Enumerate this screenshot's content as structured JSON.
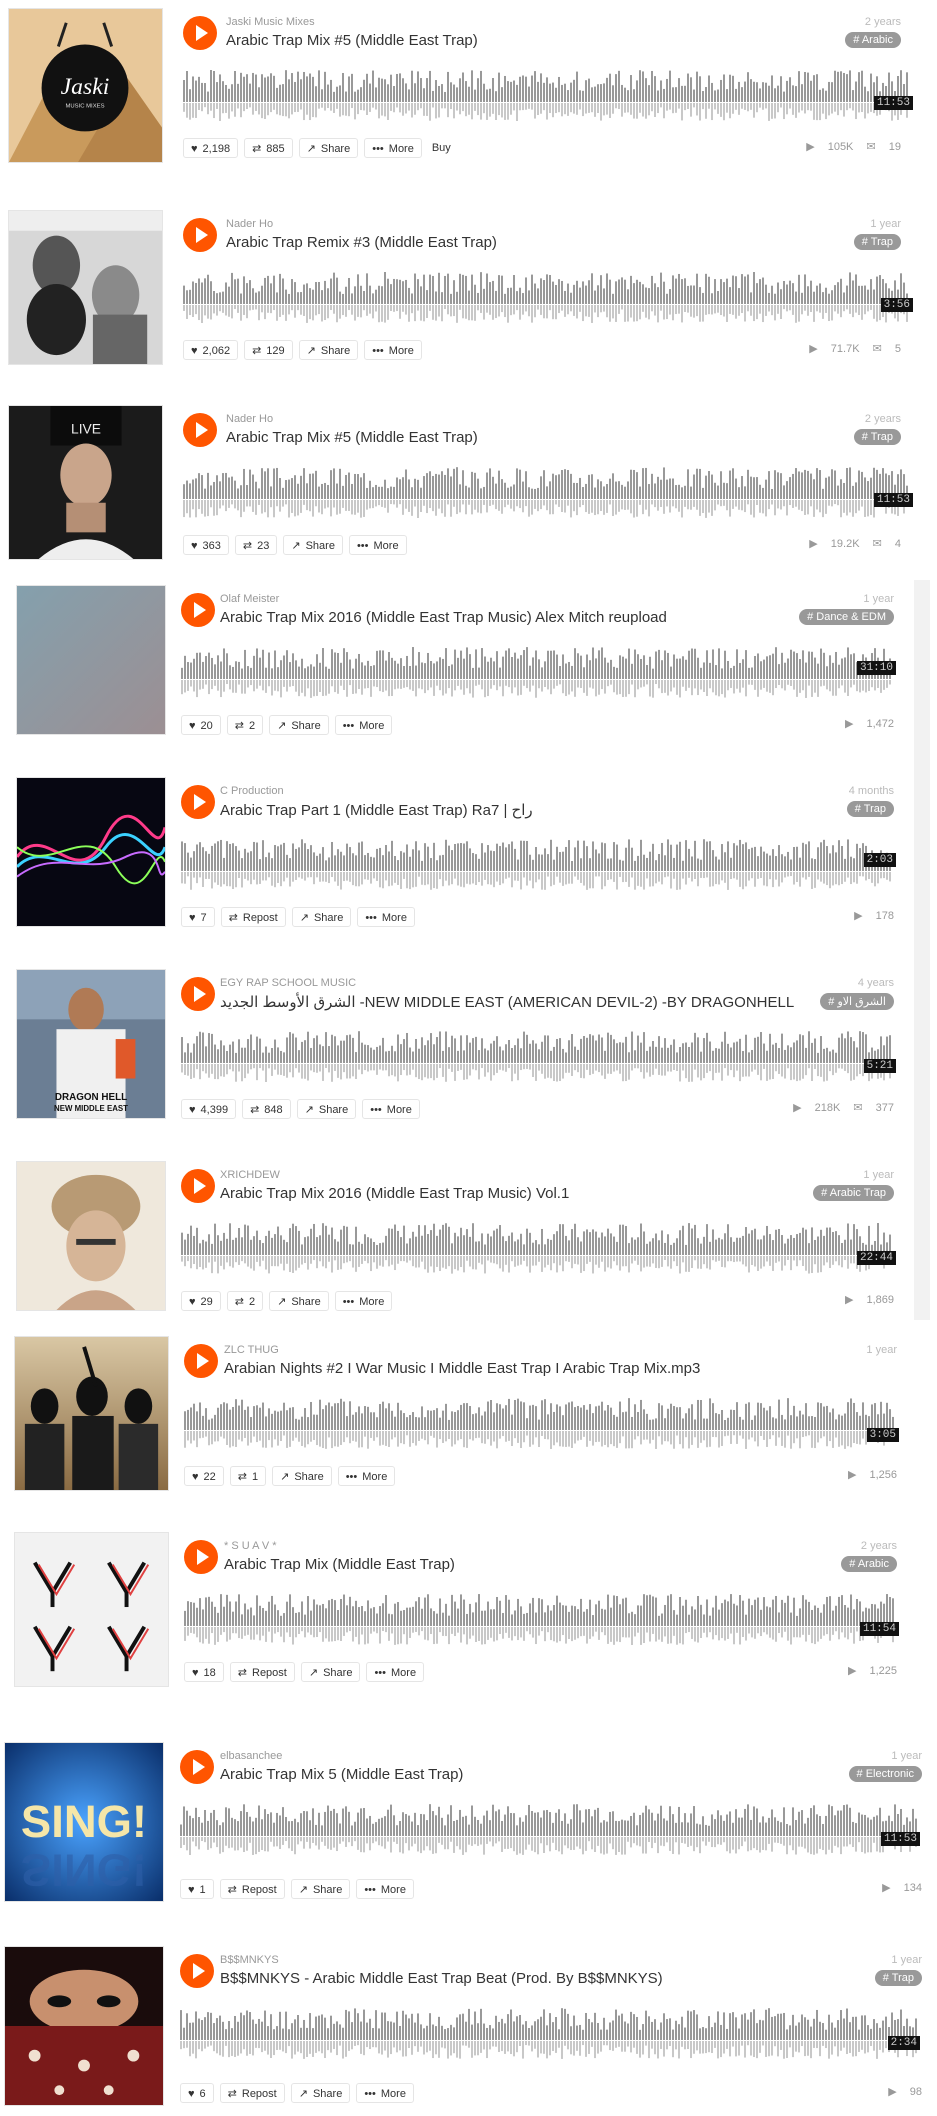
{
  "colors": {
    "accent": "#ff5500",
    "wave": "#999999",
    "tag_bg": "#999999"
  },
  "icons": {
    "play": "play-icon",
    "like": "heart-icon",
    "repost": "repost-icon",
    "share": "share-icon",
    "more": "more-icon",
    "plays": "play-count-icon",
    "comments": "comment-icon"
  },
  "tracks": [
    {
      "user": "Jaski Music Mixes",
      "title": "Arabic Trap Mix #5 (Middle East Trap)",
      "age": "2 years",
      "tag": "Arabic",
      "duration": "11:53",
      "likes": "2,198",
      "reposts": "885",
      "share": "Share",
      "more": "More",
      "buy": "Buy",
      "plays": "105K",
      "comments": "19",
      "art_text": "Jaski",
      "art_sub": "MUSIC MIXES"
    },
    {
      "user": "Nader Ho",
      "title": "Arabic Trap Remix #3 (Middle East Trap)",
      "age": "1 year",
      "tag": "Trap",
      "duration": "3:56",
      "likes": "2,062",
      "reposts": "129",
      "share": "Share",
      "more": "More",
      "plays": "71.7K",
      "comments": "5"
    },
    {
      "user": "Nader Ho",
      "title": "Arabic Trap Mix #5 (Middle East Trap)",
      "age": "2 years",
      "tag": "Trap",
      "duration": "11:53",
      "likes": "363",
      "reposts": "23",
      "share": "Share",
      "more": "More",
      "plays": "19.2K",
      "comments": "4",
      "art_text": "LIVE"
    },
    {
      "user": "Olaf Meister",
      "title": "Arabic Trap Mix 2016 (Middle East Trap Music) Alex Mitch reupload",
      "age": "1 year",
      "tag": "Dance & EDM",
      "duration": "31:10",
      "likes": "20",
      "reposts": "2",
      "share": "Share",
      "more": "More",
      "plays": "1,472"
    },
    {
      "user": "C Production",
      "title": "Arabic Trap Part 1 (Middle East Trap) Ra7 | راح",
      "age": "4 months",
      "tag": "Trap",
      "duration": "2:03",
      "likes": "7",
      "reposts": "Repost",
      "share": "Share",
      "more": "More",
      "plays": "178"
    },
    {
      "user": "EGY RAP SCHOOL MUSIC",
      "title": "الشرق الأوسط الجديد -NEW MIDDLE EAST (AMERICAN DEVIL-2) -BY DRAGONHELL",
      "age": "4 years",
      "tag": "الشرق الاو",
      "duration": "5:21",
      "likes": "4,399",
      "reposts": "848",
      "share": "Share",
      "more": "More",
      "plays": "218K",
      "comments": "377",
      "art_text": "DRAGON HELL",
      "art_sub": "NEW MIDDLE EAST"
    },
    {
      "user": "XRICHDEW",
      "title": "Arabic Trap Mix 2016 (Middle East Trap Music) Vol.1",
      "age": "1 year",
      "tag": "Arabic Trap",
      "duration": "22:44",
      "likes": "29",
      "reposts": "2",
      "share": "Share",
      "more": "More",
      "plays": "1,869"
    },
    {
      "user": "ZLC THUG",
      "title": "Arabian Nights #2 I War Music I Middle East Trap I Arabic Trap Mix.mp3",
      "age": "1 year",
      "duration": "3:05",
      "likes": "22",
      "reposts": "1",
      "share": "Share",
      "more": "More",
      "plays": "1,256"
    },
    {
      "user": "* S U A V *",
      "title": "Arabic Trap Mix (Middle East Trap)",
      "age": "2 years",
      "tag": "Arabic",
      "duration": "11:54",
      "likes": "18",
      "reposts": "Repost",
      "share": "Share",
      "more": "More",
      "plays": "1,225"
    },
    {
      "user": "elbasanchee",
      "title": "Arabic Trap Mix 5 (Middle East Trap)",
      "age": "1 year",
      "tag": "Electronic",
      "duration": "11:53",
      "likes": "1",
      "reposts": "Repost",
      "share": "Share",
      "more": "More",
      "plays": "134",
      "art_text": "SING!"
    },
    {
      "user": "B$$MNKYS",
      "title": "B$$MNKYS - Arabic Middle East Trap Beat (Prod. By B$$MNKYS)",
      "age": "1 year",
      "tag": "Trap",
      "duration": "2:34",
      "likes": "6",
      "reposts": "Repost",
      "share": "Share",
      "more": "More",
      "plays": "98"
    }
  ]
}
